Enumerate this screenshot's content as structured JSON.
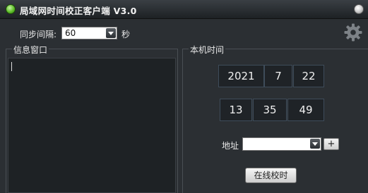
{
  "window": {
    "title": "局域网时间校正客户端 V3.0"
  },
  "sync": {
    "label": "同步间隔:",
    "value": "60",
    "unit": "秒"
  },
  "info_panel": {
    "title": "信息窗口",
    "content": ""
  },
  "clock_panel": {
    "title": "本机时间",
    "date": {
      "year": "2021",
      "month": "7",
      "day": "22"
    },
    "time": {
      "hour": "13",
      "minute": "35",
      "second": "49"
    }
  },
  "address": {
    "label": "地址",
    "value": "",
    "add_label": "+"
  },
  "actions": {
    "online_label": "在线校时"
  },
  "colors": {
    "background": "#2b2f33",
    "box_border": "#3e4c5a",
    "app_icon": "#5fbf2a"
  },
  "icons": [
    "app-icon",
    "close-icon",
    "gear-icon",
    "dropdown-arrow-icon"
  ]
}
